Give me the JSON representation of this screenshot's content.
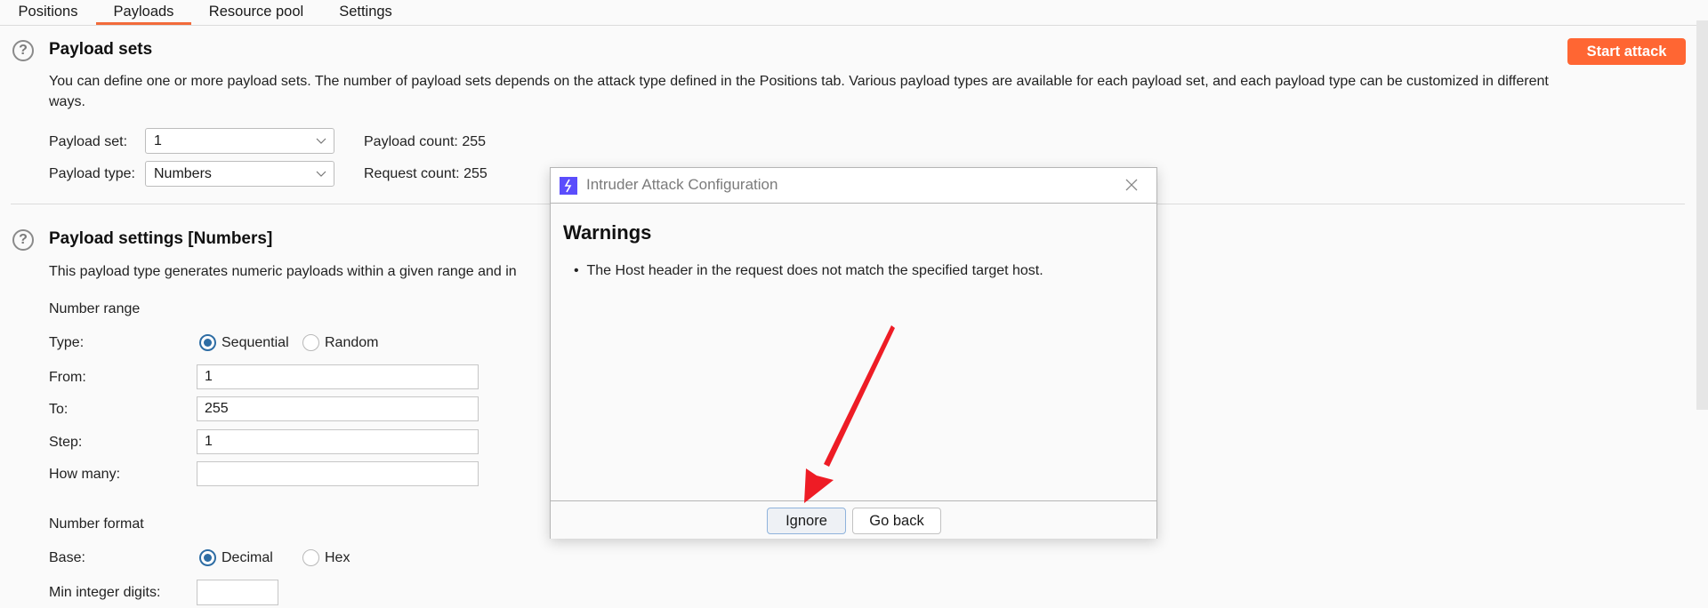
{
  "tabs": [
    {
      "label": "Positions",
      "active": false
    },
    {
      "label": "Payloads",
      "active": true
    },
    {
      "label": "Resource pool",
      "active": false
    },
    {
      "label": "Settings",
      "active": false
    }
  ],
  "colors": {
    "accent": "#ff6633",
    "tab_underline": "#f26b3a",
    "radio_selected": "#2e6da4",
    "dialog_icon": "#5b4dfc",
    "annotation_arrow": "#ee1c25"
  },
  "payload_sets": {
    "title": "Payload sets",
    "description_line1": "You can define one or more payload sets. The number of payload sets depends on the attack type defined in the Positions tab. Various payload types are available for each payload set, and each payload type can be customized in different",
    "description_line2": "ways.",
    "start_attack_label": "Start attack",
    "payload_set_label": "Payload set:",
    "payload_set_value": "1",
    "payload_type_label": "Payload type:",
    "payload_type_value": "Numbers",
    "payload_count_label": "Payload count:",
    "payload_count_value": "255",
    "request_count_label": "Request count:",
    "request_count_value": "255"
  },
  "payload_settings": {
    "title": "Payload settings [Numbers]",
    "description": "This payload type generates numeric payloads within a given range and in",
    "number_range_heading": "Number range",
    "type_label": "Type:",
    "type_options": [
      {
        "label": "Sequential",
        "selected": true
      },
      {
        "label": "Random",
        "selected": false
      }
    ],
    "from_label": "From:",
    "from_value": "1",
    "to_label": "To:",
    "to_value": "255",
    "step_label": "Step:",
    "step_value": "1",
    "how_many_label": "How many:",
    "how_many_value": "",
    "number_format_heading": "Number format",
    "base_label": "Base:",
    "base_options": [
      {
        "label": "Decimal",
        "selected": true
      },
      {
        "label": "Hex",
        "selected": false
      }
    ],
    "min_integer_digits_label": "Min integer digits:",
    "min_integer_digits_value": ""
  },
  "dialog": {
    "title": "Intruder Attack Configuration",
    "heading": "Warnings",
    "warnings": [
      "The Host header in the request does not match the specified target host."
    ],
    "ignore_label": "Ignore",
    "go_back_label": "Go back"
  }
}
